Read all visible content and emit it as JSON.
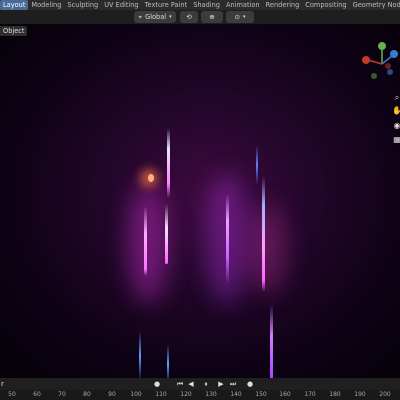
{
  "workspace_tabs": [
    "Layout",
    "Modeling",
    "Sculpting",
    "UV Editing",
    "Texture Paint",
    "Shading",
    "Animation",
    "Rendering",
    "Compositing",
    "Geometry Nodes"
  ],
  "active_tab": "Layout",
  "header": {
    "orientation": "Global"
  },
  "viewport": {
    "mode_label": "Object"
  },
  "timeline": {
    "left_label": "r",
    "ruler_ticks": [
      "50",
      "60",
      "70",
      "80",
      "90",
      "100",
      "110",
      "120",
      "130",
      "140",
      "150",
      "160",
      "170",
      "180",
      "190",
      "200"
    ]
  },
  "colors": {
    "accent": "#4a6a9a",
    "bg": "#000000",
    "panel": "#2b2b2b",
    "glow_magenta": "#ff3cff",
    "glow_violet": "#b040ff",
    "glow_orange": "#ff8040",
    "glow_blue": "#4080ff"
  },
  "icons": [
    "transform-pivot-icon",
    "snap-icon",
    "proportional-edit-icon",
    "axis-gizmo-icon",
    "pan-hand-icon",
    "camera-icon",
    "grid-icon",
    "play-icon",
    "jump-start-icon",
    "jump-end-icon",
    "keyframe-icon"
  ]
}
